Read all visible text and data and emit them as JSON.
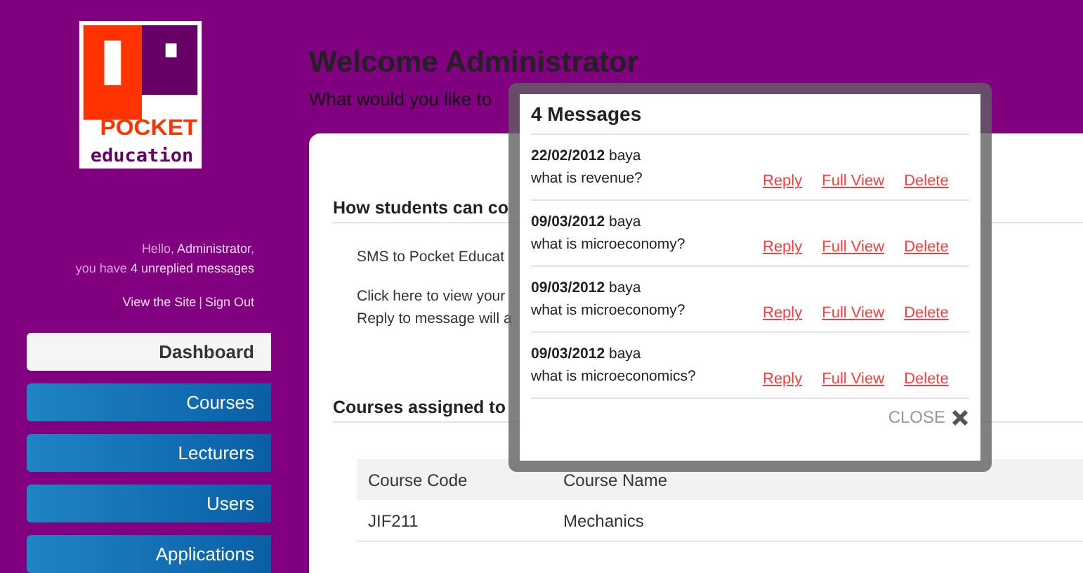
{
  "logo": {
    "word_top": "POCKET",
    "word_bottom": "education"
  },
  "greeting": {
    "line_1": "Hello, **Administrator**,",
    "line_2": "you have **4 unreplied messages**"
  },
  "account_links": [
    {
      "label": "View the Site"
    },
    {
      "label": "Sign Out"
    }
  ],
  "account_links_separator": "|",
  "nav": [
    {
      "label": "Dashboard",
      "selected": true
    },
    {
      "label": "Courses",
      "selected": false
    },
    {
      "label": "Lecturers",
      "selected": false
    },
    {
      "label": "Users",
      "selected": false
    },
    {
      "label": "Applications",
      "selected": false
    }
  ],
  "header": {
    "title": "Welcome Administrator",
    "subtitle": "What would you like to"
  },
  "sections": [
    {
      "heading": "How students can co",
      "lines": [
        "SMS to Pocket Educat",
        "Click here to view your",
        "Reply to message will a"
      ]
    },
    {
      "heading": "Courses assigned to"
    }
  ],
  "table": {
    "columns": [
      "Course Code",
      "Course Name"
    ],
    "rows": [
      [
        "JIF211",
        "Mechanics"
      ]
    ]
  },
  "messages_dialog": {
    "title": "4 Messages",
    "close_label": "CLOSE",
    "messages": [
      {
        "meta": "**22/02/2012** baya",
        "text": "what is revenue?",
        "actions": [
          "Reply",
          "Full View",
          "Delete"
        ]
      },
      {
        "meta": "**09/03/2012** baya",
        "text": "what is microeconomy?",
        "actions": [
          "Reply",
          "Full View",
          "Delete"
        ]
      },
      {
        "meta": "**09/03/2012** baya",
        "text": "what is microeconomy?",
        "actions": [
          "Reply",
          "Full View",
          "Delete"
        ]
      },
      {
        "meta": "**09/03/2012** baya",
        "text": "what is microeconomics?",
        "actions": [
          "Reply",
          "Full View",
          "Delete"
        ]
      }
    ]
  }
}
